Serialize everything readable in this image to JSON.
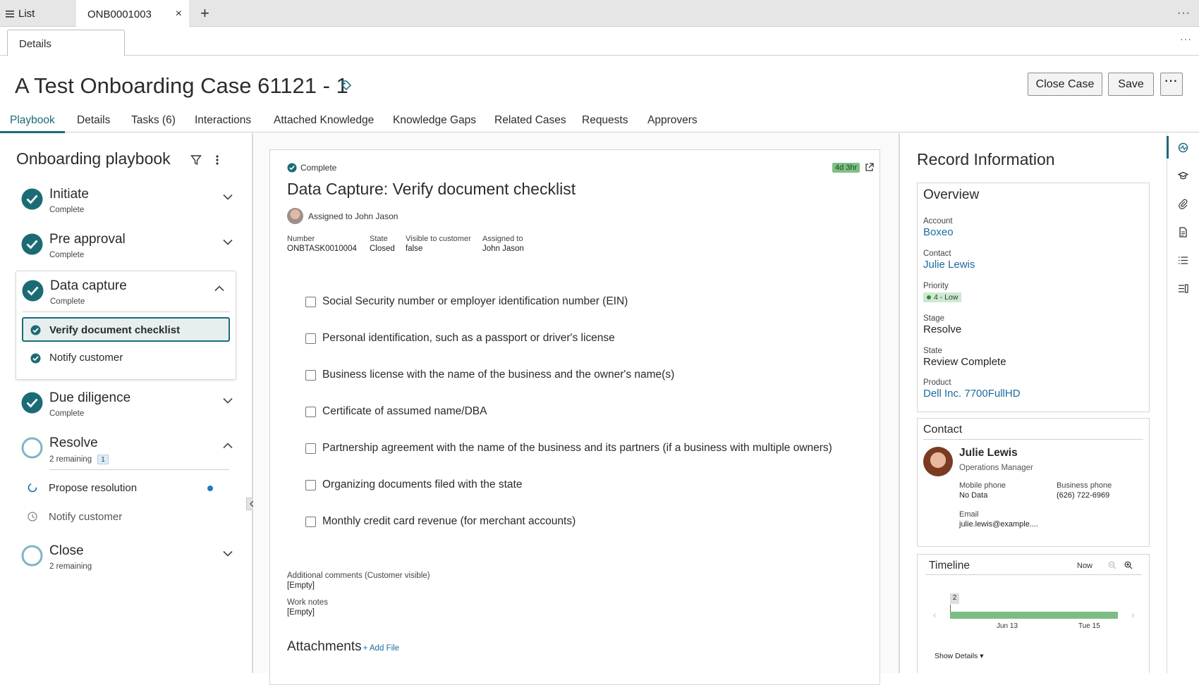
{
  "top_tabs": {
    "list_label": "List",
    "record_label": "ONB0001003",
    "close_glyph": "×",
    "new_glyph": "+",
    "more_glyph": "···"
  },
  "sub_tabs": {
    "details_label": "Details",
    "more_glyph": "···"
  },
  "header": {
    "title": "A Test Onboarding Case 61121 - 1",
    "close_case_label": "Close Case",
    "save_label": "Save",
    "more_label": "···"
  },
  "nav_tabs": [
    "Playbook",
    "Details",
    "Tasks (6)",
    "Interactions",
    "Attached Knowledge",
    "Knowledge Gaps",
    "Related Cases",
    "Requests",
    "Approvers"
  ],
  "playbook": {
    "title": "Onboarding playbook",
    "stages": [
      {
        "name": "Initiate",
        "status": "Complete"
      },
      {
        "name": "Pre approval",
        "status": "Complete"
      },
      {
        "name": "Data capture",
        "status": "Complete"
      },
      {
        "name": "Due diligence",
        "status": "Complete"
      },
      {
        "name": "Resolve",
        "status": "2 remaining",
        "badge": "1"
      },
      {
        "name": "Close",
        "status": "2 remaining"
      }
    ],
    "data_capture_tasks": [
      "Verify document checklist",
      "Notify customer"
    ],
    "resolve_tasks": [
      "Propose resolution",
      "Notify customer"
    ]
  },
  "task": {
    "state_label": "Complete",
    "sla": "4d 3hr",
    "title": "Data Capture: Verify document checklist",
    "assigned_text": "Assigned to John Jason",
    "meta": [
      {
        "label": "Number",
        "value": "ONBTASK0010004"
      },
      {
        "label": "State",
        "value": "Closed"
      },
      {
        "label": "Visible to customer",
        "value": "false"
      },
      {
        "label": "Assigned to",
        "value": "John Jason"
      }
    ],
    "checklist": [
      "Social Security number or employer identification number (EIN)",
      "Personal identification, such as a passport or driver's license",
      "Business license with the name of the business and the owner's name(s)",
      "Certificate of assumed name/DBA",
      "Partnership agreement with the name of the business and its partners (if a business with multiple owners)",
      "Organizing documents filed with the state",
      "Monthly credit card revenue (for merchant accounts)"
    ],
    "additional_comments_label": "Additional comments (Customer visible)",
    "additional_comments_value": "[Empty]",
    "work_notes_label": "Work notes",
    "work_notes_value": "[Empty]",
    "attachments_label": "Attachments",
    "add_file_label": "+ Add File"
  },
  "record_info": {
    "title": "Record Information",
    "overview_title": "Overview",
    "account_label": "Account",
    "account_value": "Boxeo",
    "contact_label": "Contact",
    "contact_value": "Julie Lewis",
    "priority_label": "Priority",
    "priority_value": "4 - Low",
    "stage_label": "Stage",
    "stage_value": "Resolve",
    "state_label": "State",
    "state_value": "Review Complete",
    "product_label": "Product",
    "product_value": "Dell Inc. 7700FullHD"
  },
  "contact_card": {
    "title": "Contact",
    "name": "Julie Lewis",
    "role": "Operations Manager",
    "mobile_label": "Mobile phone",
    "mobile_value": "No Data",
    "business_label": "Business phone",
    "business_value": "(626) 722-6969",
    "email_label": "Email",
    "email_value": "julie.lewis@example...."
  },
  "timeline": {
    "title": "Timeline",
    "now_label": "Now",
    "count": "2",
    "ticks": [
      "Jun 13",
      "Tue 15"
    ],
    "show_details_label": "Show Details ▾"
  },
  "colors": {
    "accent": "#1b6b76",
    "link": "#1b6b9e",
    "success": "#7cbd83"
  },
  "icons": [
    "list-icon",
    "tag-icon",
    "filter-icon",
    "kebab-icon",
    "check-circle-icon",
    "chevron-down-icon",
    "chevron-up-icon",
    "open-in-new-icon",
    "zoom-in-icon",
    "zoom-out-icon",
    "paperclip-icon",
    "document-icon",
    "list-lines-icon",
    "cap-icon",
    "activity-icon",
    "clock-icon",
    "spinner-icon"
  ]
}
